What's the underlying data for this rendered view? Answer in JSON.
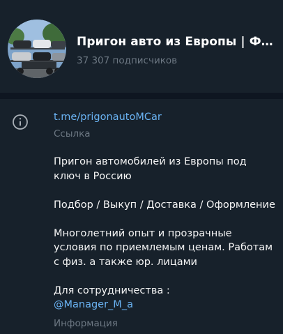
{
  "channel": {
    "title": "Пригон авто из Европы | Франция",
    "subscribers": "37 307 подписчиков"
  },
  "info": {
    "icon": "info-icon",
    "link": "t.me/prigonautoMCar",
    "link_caption": "Ссылка",
    "description": {
      "line1": "Пригон автомобилей из Европы под ключ в Россию",
      "line2": "Подбор / Выкуп / Доставка / Оформление",
      "line3": "Многолетний опыт и прозрачные условия по приемлемым ценам. Работам с физ. а также юр. лицами",
      "line4": "Для сотрудничества :",
      "handle": "@Manager_M_a"
    },
    "description_caption": "Информация"
  },
  "colors": {
    "background": "#17212b",
    "divider": "#0e1621",
    "accent": "#6ab3f3",
    "muted": "#6d7883"
  }
}
